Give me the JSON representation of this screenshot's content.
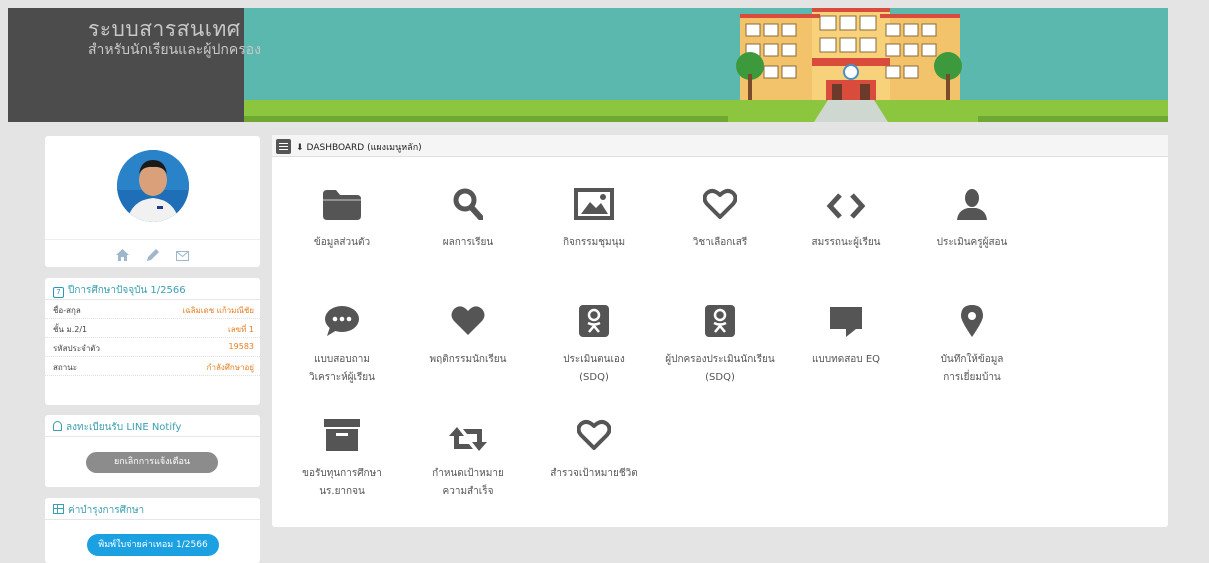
{
  "header": {
    "title": "ระบบสารสนเทศ",
    "subtitle": "สำหรับนักเรียนและผู้ปกครอง"
  },
  "profile": {
    "actions": [
      "home-icon",
      "edit-icon",
      "mail-icon"
    ]
  },
  "year_section": {
    "title": "ปีการศึกษาปัจจุบัน 1/2566",
    "rows": [
      {
        "label": "ชื่อ-สกุล",
        "value": "เฉลิมเดช แก้วมณีชัย"
      },
      {
        "label": "ชั้น ม.2/1",
        "value": "เลขที่ 1"
      },
      {
        "label": "รหัสประจำตัว",
        "value": "19583"
      },
      {
        "label": "สถานะ",
        "value": "กำลังศึกษาอยู่"
      }
    ]
  },
  "line_section": {
    "title": "ลงทะเบียนรับ LINE Notify",
    "button": "ยกเลิกการแจ้งเตือน"
  },
  "fee_section": {
    "title": "ค่าบำรุงการศึกษา",
    "button": "พิมพ์ใบจ่ายค่าเทอม 1/2566"
  },
  "dashboard": {
    "title": "DASHBOARD (แผงเมนูหลัก)",
    "tiles": [
      {
        "icon": "folder-icon",
        "line1": "ข้อมูลส่วนตัว",
        "line2": ""
      },
      {
        "icon": "search-icon",
        "line1": "ผลการเรียน",
        "line2": ""
      },
      {
        "icon": "image-icon",
        "line1": "กิจกรรมชุมนุม",
        "line2": ""
      },
      {
        "icon": "heart-outline-icon",
        "line1": "วิชาเลือกเสรี",
        "line2": ""
      },
      {
        "icon": "code-icon",
        "line1": "สมรรถนะผู้เรียน",
        "line2": ""
      },
      {
        "icon": "user-icon",
        "line1": "ประเมินครูผู้สอน",
        "line2": ""
      },
      {
        "icon": "chat-icon",
        "line1": "แบบสอบถาม",
        "line2": "วิเคราะห์ผู้เรียน"
      },
      {
        "icon": "heart-filled-icon",
        "line1": "พฤติกรรมนักเรียน",
        "line2": ""
      },
      {
        "icon": "odnoklassniki-icon",
        "line1": "ประเมินตนเอง",
        "line2": "(SDQ)"
      },
      {
        "icon": "odnoklassniki-icon",
        "line1": "ผู้ปกครองประเมินนักเรียน",
        "line2": "(SDQ)"
      },
      {
        "icon": "comment-icon",
        "line1": "แบบทดสอบ EQ",
        "line2": ""
      },
      {
        "icon": "map-pin-icon",
        "line1": "บันทึกให้ข้อมูล",
        "line2": "การเยี่ยมบ้าน"
      },
      {
        "icon": "archive-icon",
        "line1": "ขอรับทุนการศึกษา",
        "line2": "นร.ยากจน"
      },
      {
        "icon": "retweet-icon",
        "line1": "กำหนดเป้าหมาย",
        "line2": "ความสำเร็จ"
      },
      {
        "icon": "heart-outline-icon",
        "line1": "สำรวจเป้าหมายชีวิต",
        "line2": ""
      }
    ]
  },
  "colors": {
    "header_bg": "#5ab8ae",
    "brand_bg": "#4c4c4c",
    "accent": "#1ba1e2",
    "value_text": "#e67e22"
  }
}
